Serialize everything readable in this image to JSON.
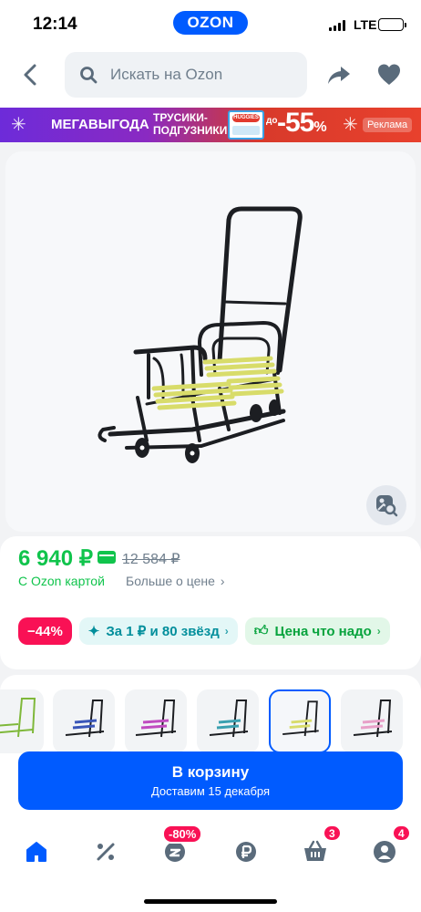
{
  "status_bar": {
    "time": "12:14",
    "carrier_logo": "OZON",
    "network": "LTE"
  },
  "header": {
    "search_placeholder": "Искать на Ozon"
  },
  "banner": {
    "title": "МЕГАВЫГОДА",
    "subtitle_line1": "ТРУСИКИ-",
    "subtitle_line2": "ПОДГУЗНИКИ",
    "brand": "HUGGIES",
    "upto": "до",
    "discount": "-55",
    "discount_unit": "%",
    "ad_label": "Реклама"
  },
  "product": {
    "price": "6 940 ₽",
    "old_price": "12 584 ₽",
    "ozon_card_label": "С Ozon картой",
    "more_about_price": "Больше о цене"
  },
  "chips": {
    "discount": "−44%",
    "stars": "За 1 ₽ и 80 звёзд",
    "fair_price": "Цена что надо"
  },
  "cart_button": {
    "label": "В корзину",
    "delivery": "Доставим 15 декабря"
  },
  "nav": {
    "promo_badge": "-80%",
    "cart_badge": "3",
    "profile_badge": "4"
  },
  "colors": {
    "ozon_blue": "#005bff",
    "price_green": "#10c44c",
    "discount_red": "#f91155",
    "sled_seat": "#d8dc6a"
  },
  "thumbnail_variants": [
    "green",
    "blue",
    "purple",
    "teal",
    "yellow-selected",
    "pink"
  ]
}
